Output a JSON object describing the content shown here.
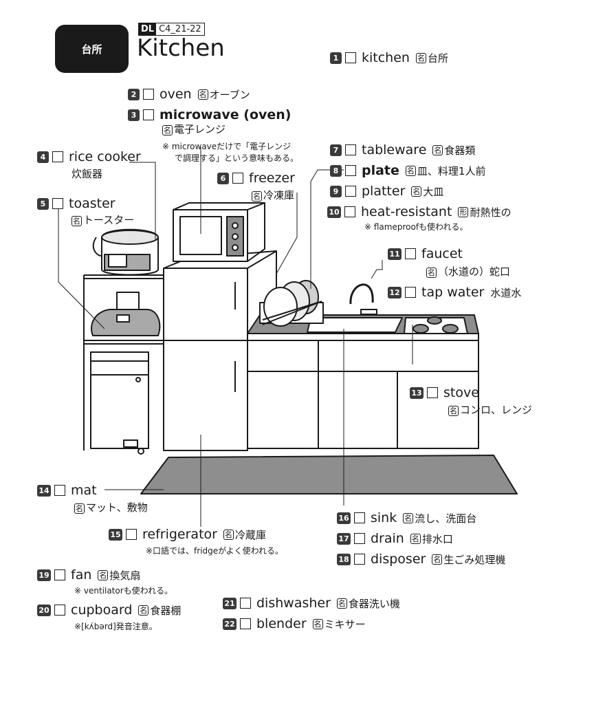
{
  "header": {
    "section_label": "台所",
    "dl_tag": "DL",
    "dl_code": "C4_21-22",
    "title": "Kitchen"
  },
  "entries": [
    {
      "num": "1",
      "word": "kitchen",
      "bold": false,
      "pos": "名",
      "meaning": "台所"
    },
    {
      "num": "2",
      "word": "oven",
      "bold": false,
      "pos": "名",
      "meaning": "オーブン"
    },
    {
      "num": "3",
      "word": "microwave (oven)",
      "bold": true,
      "pos": "名",
      "meaning": "電子レンジ",
      "note": "※ microwaveだけで「電子レンジで調理する」という意味もある。",
      "note_line1": "※ microwaveだけで「電子レンジ",
      "note_line2": "で調理する」という意味もある。"
    },
    {
      "num": "4",
      "word": "rice cooker",
      "bold": false,
      "pos": "",
      "meaning": "炊飯器"
    },
    {
      "num": "5",
      "word": "toaster",
      "bold": false,
      "pos": "名",
      "meaning": "トースター"
    },
    {
      "num": "6",
      "word": "freezer",
      "bold": false,
      "pos": "名",
      "meaning": "冷凍庫"
    },
    {
      "num": "7",
      "word": "tableware",
      "bold": false,
      "pos": "名",
      "meaning": "食器類"
    },
    {
      "num": "8",
      "word": "plate",
      "bold": true,
      "pos": "名",
      "meaning": "皿、料理1人前"
    },
    {
      "num": "9",
      "word": "platter",
      "bold": false,
      "pos": "名",
      "meaning": "大皿"
    },
    {
      "num": "10",
      "word": "heat-resistant",
      "bold": false,
      "pos": "形",
      "meaning": "耐熱性の",
      "note": "※ flameproofも使われる。"
    },
    {
      "num": "11",
      "word": "faucet",
      "bold": false,
      "pos": "名",
      "meaning": "（水道の）蛇口"
    },
    {
      "num": "12",
      "word": "tap water",
      "bold": false,
      "pos": "",
      "meaning": "水道水"
    },
    {
      "num": "13",
      "word": "stove",
      "bold": false,
      "pos": "名",
      "meaning": "コンロ、レンジ"
    },
    {
      "num": "14",
      "word": "mat",
      "bold": false,
      "pos": "名",
      "meaning": "マット、敷物"
    },
    {
      "num": "15",
      "word": "refrigerator",
      "bold": false,
      "pos": "名",
      "meaning": "冷蔵庫",
      "note": "※口語では、fridgeがよく使われる。"
    },
    {
      "num": "16",
      "word": "sink",
      "bold": false,
      "pos": "名",
      "meaning": "流し、洗面台"
    },
    {
      "num": "17",
      "word": "drain",
      "bold": false,
      "pos": "名",
      "meaning": "排水口"
    },
    {
      "num": "18",
      "word": "disposer",
      "bold": false,
      "pos": "名",
      "meaning": "生ごみ処理機"
    },
    {
      "num": "19",
      "word": "fan",
      "bold": false,
      "pos": "名",
      "meaning": "換気扇",
      "note": "※ ventilatorも使われる。"
    },
    {
      "num": "20",
      "word": "cupboard",
      "bold": false,
      "pos": "名",
      "meaning": "食器棚",
      "note": "※[kʌ́bərd]発音注意。"
    },
    {
      "num": "21",
      "word": "dishwasher",
      "bold": false,
      "pos": "名",
      "meaning": "食器洗い機"
    },
    {
      "num": "22",
      "word": "blender",
      "bold": false,
      "pos": "名",
      "meaning": "ミキサー"
    }
  ]
}
